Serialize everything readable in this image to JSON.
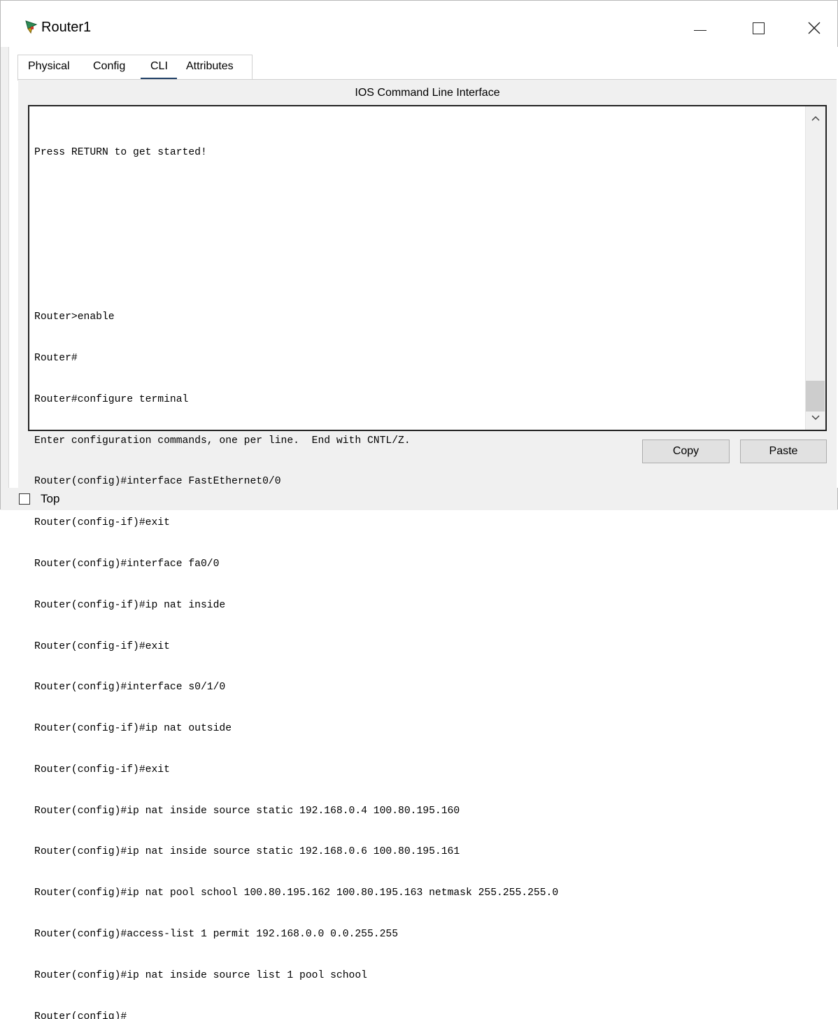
{
  "window": {
    "title": "Router1",
    "controls": [
      "minimize",
      "maximize",
      "close"
    ]
  },
  "tabs": [
    {
      "label": "Physical",
      "active": false
    },
    {
      "label": "Config",
      "active": false
    },
    {
      "label": "CLI",
      "active": true
    },
    {
      "label": "Attributes",
      "active": false
    }
  ],
  "cli": {
    "title": "IOS Command Line Interface",
    "lines": [
      "Press RETURN to get started!",
      "",
      "",
      "",
      "Router>enable",
      "Router#",
      "Router#configure terminal",
      "Enter configuration commands, one per line.  End with CNTL/Z.",
      "Router(config)#interface FastEthernet0/0",
      "Router(config-if)#exit",
      "Router(config)#interface fa0/0",
      "Router(config-if)#ip nat inside",
      "Router(config-if)#exit",
      "Router(config)#interface s0/1/0",
      "Router(config-if)#ip nat outside",
      "Router(config-if)#exit",
      "Router(config)#ip nat inside source static 192.168.0.4 100.80.195.160",
      "Router(config)#ip nat inside source static 192.168.0.6 100.80.195.161",
      "Router(config)#ip nat pool school 100.80.195.162 100.80.195.163 netmask 255.255.255.0",
      "Router(config)#access-list 1 permit 192.168.0.0 0.0.255.255",
      "Router(config)#ip nat inside source list 1 pool school",
      "Router(config)#"
    ]
  },
  "buttons": {
    "copy": "Copy",
    "paste": "Paste"
  },
  "footer": {
    "top_label": "Top",
    "top_checked": false
  },
  "icons": {
    "app": "router-icon",
    "scroll_up": "chevron-up-icon",
    "scroll_down": "chevron-down-icon"
  }
}
